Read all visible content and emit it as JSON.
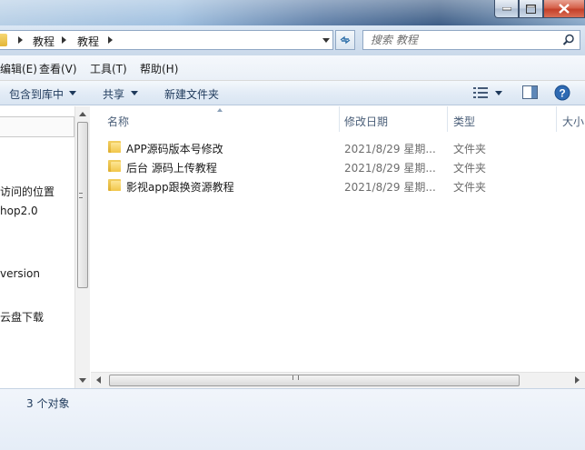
{
  "window": {
    "colors": {
      "close_button": "#c4402a",
      "selection_accent": "#3c7fb1"
    }
  },
  "address": {
    "crumbs": [
      "教程",
      "教程"
    ],
    "search_placeholder": "搜索 教程"
  },
  "menubar": {
    "items": [
      "编辑(E)",
      "查看(V)",
      "工具(T)",
      "帮助(H)"
    ]
  },
  "commandbar": {
    "include_library": "包含到库中",
    "share": "共享",
    "new_folder": "新建文件夹"
  },
  "navpane": {
    "items": [
      "访问的位置",
      "hop2.0",
      "version",
      "云盘下载"
    ]
  },
  "filelist": {
    "columns": [
      "名称",
      "修改日期",
      "类型",
      "大小"
    ],
    "rows": [
      {
        "name": "APP源码版本号修改",
        "date": "2021/8/29 星期...",
        "type": "文件夹",
        "icon": "folder-icon"
      },
      {
        "name": "后台 源码上传教程",
        "date": "2021/8/29 星期...",
        "type": "文件夹",
        "icon": "folder-icon"
      },
      {
        "name": "影视app跟换资源教程",
        "date": "2021/8/29 星期...",
        "type": "文件夹",
        "icon": "folder-icon"
      }
    ]
  },
  "status": {
    "item_count": "3 个对象"
  }
}
